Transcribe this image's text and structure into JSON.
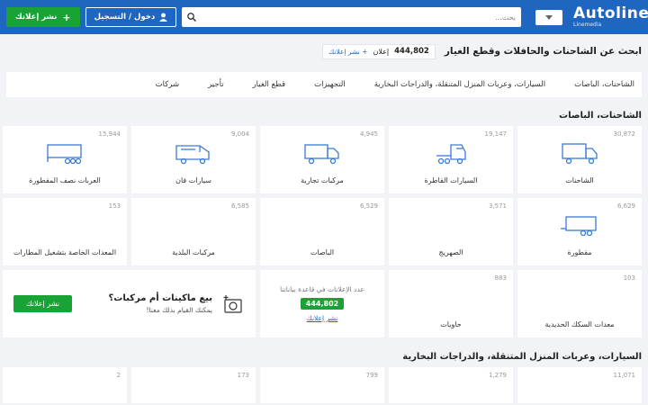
{
  "header": {
    "logo_text": "Autoline",
    "logo_sub": "Linemedia",
    "search_placeholder": "بحث...",
    "login_label": "دخول / التسجيل",
    "post_label": "نشر إعلانك"
  },
  "title_row": {
    "title": "ابحث عن الشاحنات والحافلات وقطع الغيار",
    "count": "444,802",
    "count_unit": "إعلان",
    "post_link": "+ نشر إعلانك"
  },
  "tabs": [
    "الشاحنات، الباصات",
    "السيارات، وعربات المنزل المتنقلة، والدراجات البخارية",
    "التجهيزات",
    "قطع الغيار",
    "تأجير",
    "شركات"
  ],
  "sections": {
    "trucks_title": "الشاحنات، الباصات",
    "cars_title": "السيارات، وعربات المنزل المتنقلة، والدراجات البخارية"
  },
  "cards": [
    {
      "count": "30,872",
      "label": "الشاحنات",
      "icon": "box-truck-icon"
    },
    {
      "count": "19,147",
      "label": "السيارات القاطرة",
      "icon": "tractor-unit-icon"
    },
    {
      "count": "4,945",
      "label": "مركبات تجارية",
      "icon": "light-truck-icon"
    },
    {
      "count": "9,004",
      "label": "سيارات فان",
      "icon": "van-icon"
    },
    {
      "count": "15,944",
      "label": "العربات نصف المقطورة",
      "icon": "semi-trailer-icon"
    },
    {
      "count": "6,629",
      "label": "مقطورة",
      "icon": "trailer-icon"
    },
    {
      "count": "3,571",
      "label": "الصهريج",
      "icon": ""
    },
    {
      "count": "6,529",
      "label": "الباصات",
      "icon": ""
    },
    {
      "count": "6,585",
      "label": "مركبات البلدية",
      "icon": ""
    },
    {
      "count": "153",
      "label": "المعدات الخاصة بتشغيل المطارات",
      "icon": ""
    },
    {
      "count": "103",
      "label": "معدات السكك الحديدية",
      "icon": ""
    },
    {
      "count": "883",
      "label": "حاويات",
      "icon": ""
    }
  ],
  "stat": {
    "text": "عدد الإعلانات في قاعدة بياناتنا",
    "number": "444,802",
    "link": "نشر إعلانك"
  },
  "promo": {
    "heading": "بيع ماكينات أم مركبات؟",
    "sub": "يمكنك القيام بذلك معنا!",
    "button": "نشر إعلانك"
  },
  "cars_counts": [
    "11,071",
    "1,279",
    "799",
    "173",
    "2"
  ],
  "colors": {
    "brand": "#1f66c1",
    "accent": "#19a336",
    "icon": "#3a7bd5"
  }
}
